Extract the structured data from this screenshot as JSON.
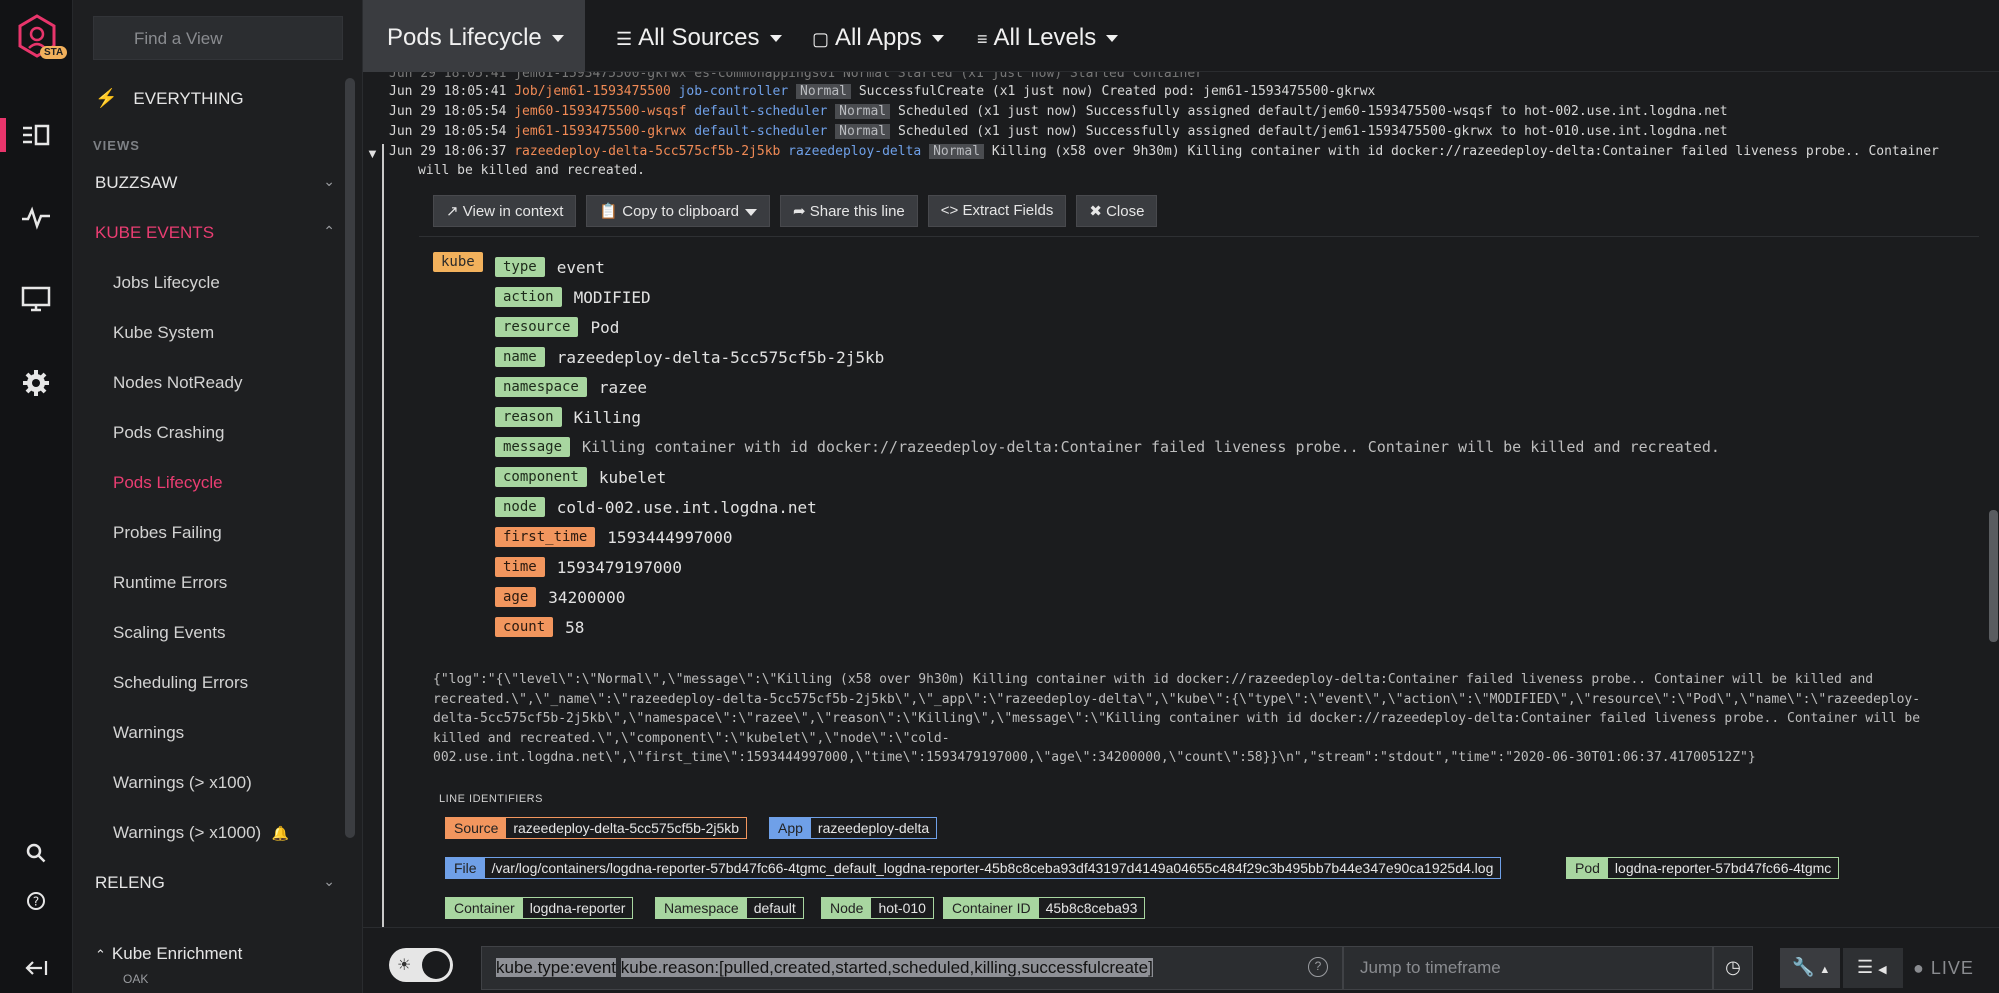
{
  "rail": {
    "badge": "STA"
  },
  "views": {
    "find_placeholder": "Find a View",
    "everything": "EVERYTHING",
    "section_views": "VIEWS",
    "groups": {
      "buzzsaw": "BUZZSAW",
      "kube_events": "KUBE EVENTS",
      "releng": "RELENG"
    },
    "kube_items": [
      "Jobs Lifecycle",
      "Kube System",
      "Nodes NotReady",
      "Pods Crashing",
      "Pods Lifecycle",
      "Probes Failing",
      "Runtime Errors",
      "Scaling Events",
      "Scheduling Errors",
      "Warnings",
      "Warnings (> x100)",
      "Warnings (> x1000)"
    ],
    "active_item": "Pods Lifecycle",
    "enrichment": "Kube Enrichment",
    "enrichment_sub": "OAK"
  },
  "topbar": {
    "view_title": "Pods Lifecycle",
    "sources": "All Sources",
    "apps": "All Apps",
    "levels": "All Levels"
  },
  "log_lines": [
    {
      "ts": "Jun 29 18:05:41",
      "source": "Job/jem61-1593475500",
      "app": "job-controller",
      "level": "Normal",
      "text": "SuccessfulCreate  (x1 just now)  Created pod: jem61-1593475500-gkrwx"
    },
    {
      "ts": "Jun 29 18:05:54",
      "source": "jem60-1593475500-wsqsf",
      "app": "default-scheduler",
      "level": "Normal",
      "text": "Scheduled  (x1 just now)  Successfully assigned default/jem60-1593475500-wsqsf to hot-002.use.int.logdna.net"
    },
    {
      "ts": "Jun 29 18:05:54",
      "source": "jem61-1593475500-gkrwx",
      "app": "default-scheduler",
      "level": "Normal",
      "text": "Scheduled  (x1 just now)  Successfully assigned default/jem61-1593475500-gkrwx to hot-010.use.int.logdna.net"
    },
    {
      "ts": "Jun 29 18:06:37",
      "source": "razeedeploy-delta-5cc575cf5b-2j5kb",
      "app": "razeedeploy-delta",
      "level": "Normal",
      "text": "Killing  (x58 over 9h30m)  Killing container with id docker://razeedeploy-delta:Container failed liveness probe.. Container",
      "cont": "will be killed and recreated."
    }
  ],
  "line_actions": {
    "view_context": "View in context",
    "copy": "Copy to clipboard",
    "share": "Share this line",
    "extract": "Extract Fields",
    "close": "Close"
  },
  "kube_tag": "kube",
  "fields": [
    {
      "k": "type",
      "v": "event",
      "color": "green"
    },
    {
      "k": "action",
      "v": "MODIFIED",
      "color": "green"
    },
    {
      "k": "resource",
      "v": "Pod",
      "color": "green"
    },
    {
      "k": "name",
      "v": "razeedeploy-delta-5cc575cf5b-2j5kb",
      "color": "green"
    },
    {
      "k": "namespace",
      "v": "razee",
      "color": "green"
    },
    {
      "k": "reason",
      "v": "Killing",
      "color": "green"
    },
    {
      "k": "message",
      "v": "Killing container with id docker://razeedeploy-delta:Container failed liveness probe.. Container will be killed and recreated.",
      "color": "green"
    },
    {
      "k": "component",
      "v": "kubelet",
      "color": "green"
    },
    {
      "k": "node",
      "v": "cold-002.use.int.logdna.net",
      "color": "green"
    },
    {
      "k": "first_time",
      "v": "1593444997000",
      "color": "orange"
    },
    {
      "k": "time",
      "v": "1593479197000",
      "color": "orange"
    },
    {
      "k": "age",
      "v": "34200000",
      "color": "orange"
    },
    {
      "k": "count",
      "v": "58",
      "color": "orange"
    }
  ],
  "raw_lines": [
    "{\"log\":\"{\\\"level\\\":\\\"Normal\\\",\\\"message\\\":\\\"Killing (x58 over 9h30m) Killing container with id docker://razeedeploy-delta:Container failed liveness probe.. Container will be killed and",
    "recreated.\\\",\\\"_name\\\":\\\"razeedeploy-delta-5cc575cf5b-2j5kb\\\",\\\"_app\\\":\\\"razeedeploy-delta\\\",\\\"kube\\\":{\\\"type\\\":\\\"event\\\",\\\"action\\\":\\\"MODIFIED\\\",\\\"resource\\\":\\\"Pod\\\",\\\"name\\\":\\\"razeedeploy-",
    "delta-5cc575cf5b-2j5kb\\\",\\\"namespace\\\":\\\"razee\\\",\\\"reason\\\":\\\"Killing\\\",\\\"message\\\":\\\"Killing container with id docker://razeedeploy-delta:Container failed liveness probe.. Container will be",
    "killed and recreated.\\\",\\\"component\\\":\\\"kubelet\\\",\\\"node\\\":\\\"cold-",
    "002.use.int.logdna.net\\\",\\\"first_time\\\":1593444997000,\\\"time\\\":1593479197000,\\\"age\\\":34200000,\\\"count\\\":58}}\\n\",\"stream\":\"stdout\",\"time\":\"2020-06-30T01:06:37.41700512Z\"}"
  ],
  "line_identifiers": {
    "title": "LINE IDENTIFIERS",
    "source": {
      "k": "Source",
      "v": "razeedeploy-delta-5cc575cf5b-2j5kb"
    },
    "app": {
      "k": "App",
      "v": "razeedeploy-delta"
    },
    "file": {
      "k": "File",
      "v": "/var/log/containers/logdna-reporter-57bd47fc66-4tgmc_default_logdna-reporter-45b8c8ceba93df43197d4149a04655c484f29c3b495bb7b44e347e90ca1925d4.log"
    },
    "pod": {
      "k": "Pod",
      "v": "logdna-reporter-57bd47fc66-4tgmc"
    },
    "container": {
      "k": "Container",
      "v": "logdna-reporter"
    },
    "namespace": {
      "k": "Namespace",
      "v": "default"
    },
    "node": {
      "k": "Node",
      "v": "hot-010"
    },
    "container_id": {
      "k": "Container ID",
      "v": "45b8c8ceba93"
    }
  },
  "bottombar": {
    "query_a": "kube.type:event",
    "query_b": "kube.reason:[pulled,created,started,scheduled,killing,successfulcreate]",
    "jump_placeholder": "Jump to timeframe",
    "live": "LIVE"
  }
}
